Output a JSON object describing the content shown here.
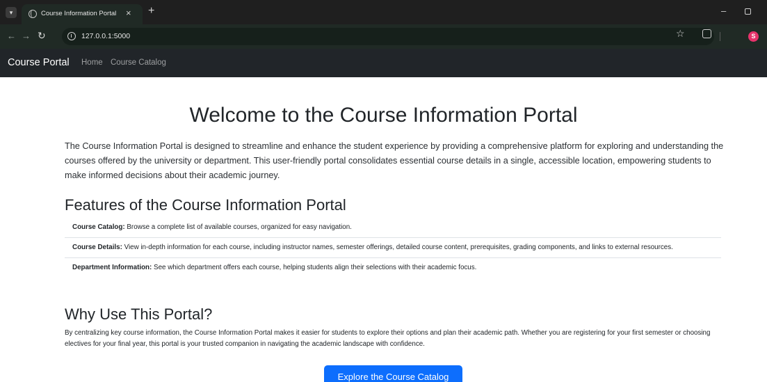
{
  "browser": {
    "tab_title": "Course Information Portal",
    "tab_close": "×",
    "new_tab": "+",
    "url": "127.0.0.1:5000",
    "profile_initial": "S",
    "icons": [
      "chevron-down-icon",
      "globe-icon",
      "close-icon",
      "plus-icon",
      "back-icon",
      "forward-icon",
      "reload-icon",
      "site-info-icon",
      "star-icon",
      "extensions-icon",
      "minimize-icon",
      "maximize-icon"
    ]
  },
  "navbar": {
    "brand": "Course Portal",
    "links": [
      "Home",
      "Course Catalog"
    ]
  },
  "main": {
    "title": "Welcome to the Course Information Portal",
    "intro": "The Course Information Portal is designed to streamline and enhance the student experience by providing a comprehensive platform for exploring and understanding the courses offered by the university or department. This user-friendly portal consolidates essential course details in a single, accessible location, empowering students to make informed decisions about their academic journey.",
    "features_title": "Features of the Course Information Portal",
    "features": [
      {
        "label": "Course Catalog:",
        "text": " Browse a complete list of available courses, organized for easy navigation."
      },
      {
        "label": "Course Details:",
        "text": " View in-depth information for each course, including instructor names, semester offerings, detailed course content, prerequisites, grading components, and links to external resources."
      },
      {
        "label": "Department Information:",
        "text": " See which department offers each course, helping students align their selections with their academic focus."
      }
    ],
    "why_title": "Why Use This Portal?",
    "why_text": "By centralizing key course information, the Course Information Portal makes it easier for students to explore their options and plan their academic path. Whether you are registering for your first semester or choosing electives for your final year, this portal is your trusted companion in navigating the academic landscape with confidence.",
    "cta_label": "Explore the Course Catalog"
  },
  "colors": {
    "navbar_bg": "#212529",
    "primary_button": "#0d6efd",
    "browser_frame": "#1f1f1f",
    "browser_toolbar": "#202a25",
    "profile_avatar": "#e8336b"
  }
}
